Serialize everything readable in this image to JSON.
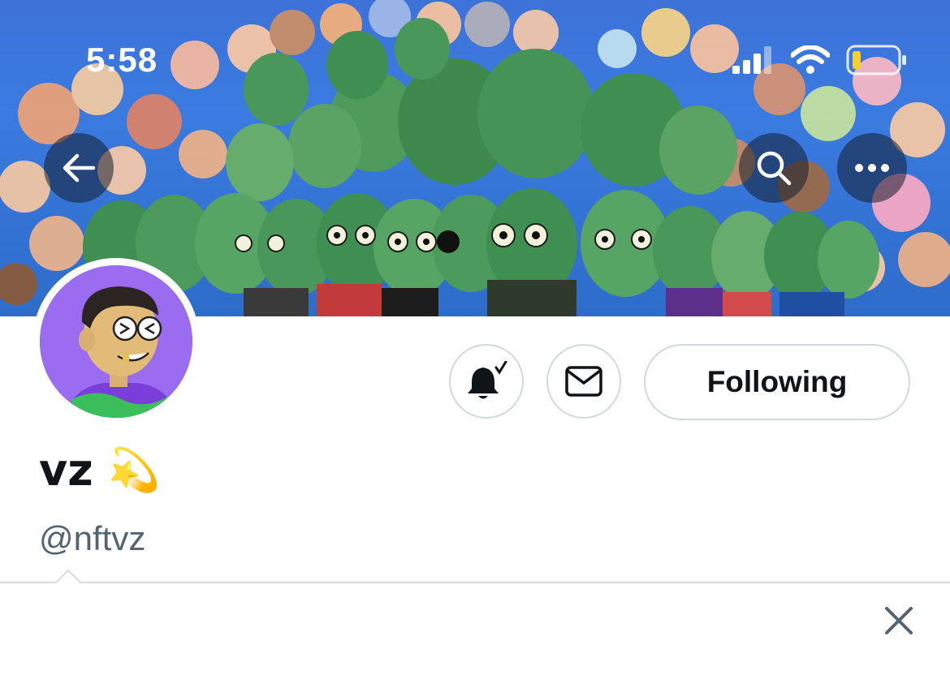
{
  "status_bar": {
    "time": "5:58",
    "icons": [
      "cellular-signal-icon",
      "wifi-icon",
      "battery-icon"
    ]
  },
  "banner": {
    "description_icons": [
      "back-arrow-icon",
      "search-icon",
      "more-icon"
    ]
  },
  "actions": {
    "notifications_icon": "bell-subscribed-icon",
    "message_icon": "envelope-icon",
    "follow_label": "Following"
  },
  "profile": {
    "display_name": "vz",
    "name_emoji": "💫",
    "handle": "@nftvz"
  },
  "popover": {
    "close_icon": "close-icon"
  },
  "colors": {
    "banner_blue": "#3a7be0",
    "zombie_green": "#3f8f52",
    "avatar_purple": "#9a6cf0",
    "border_gray": "#cfd9de",
    "text_secondary": "#536471"
  }
}
